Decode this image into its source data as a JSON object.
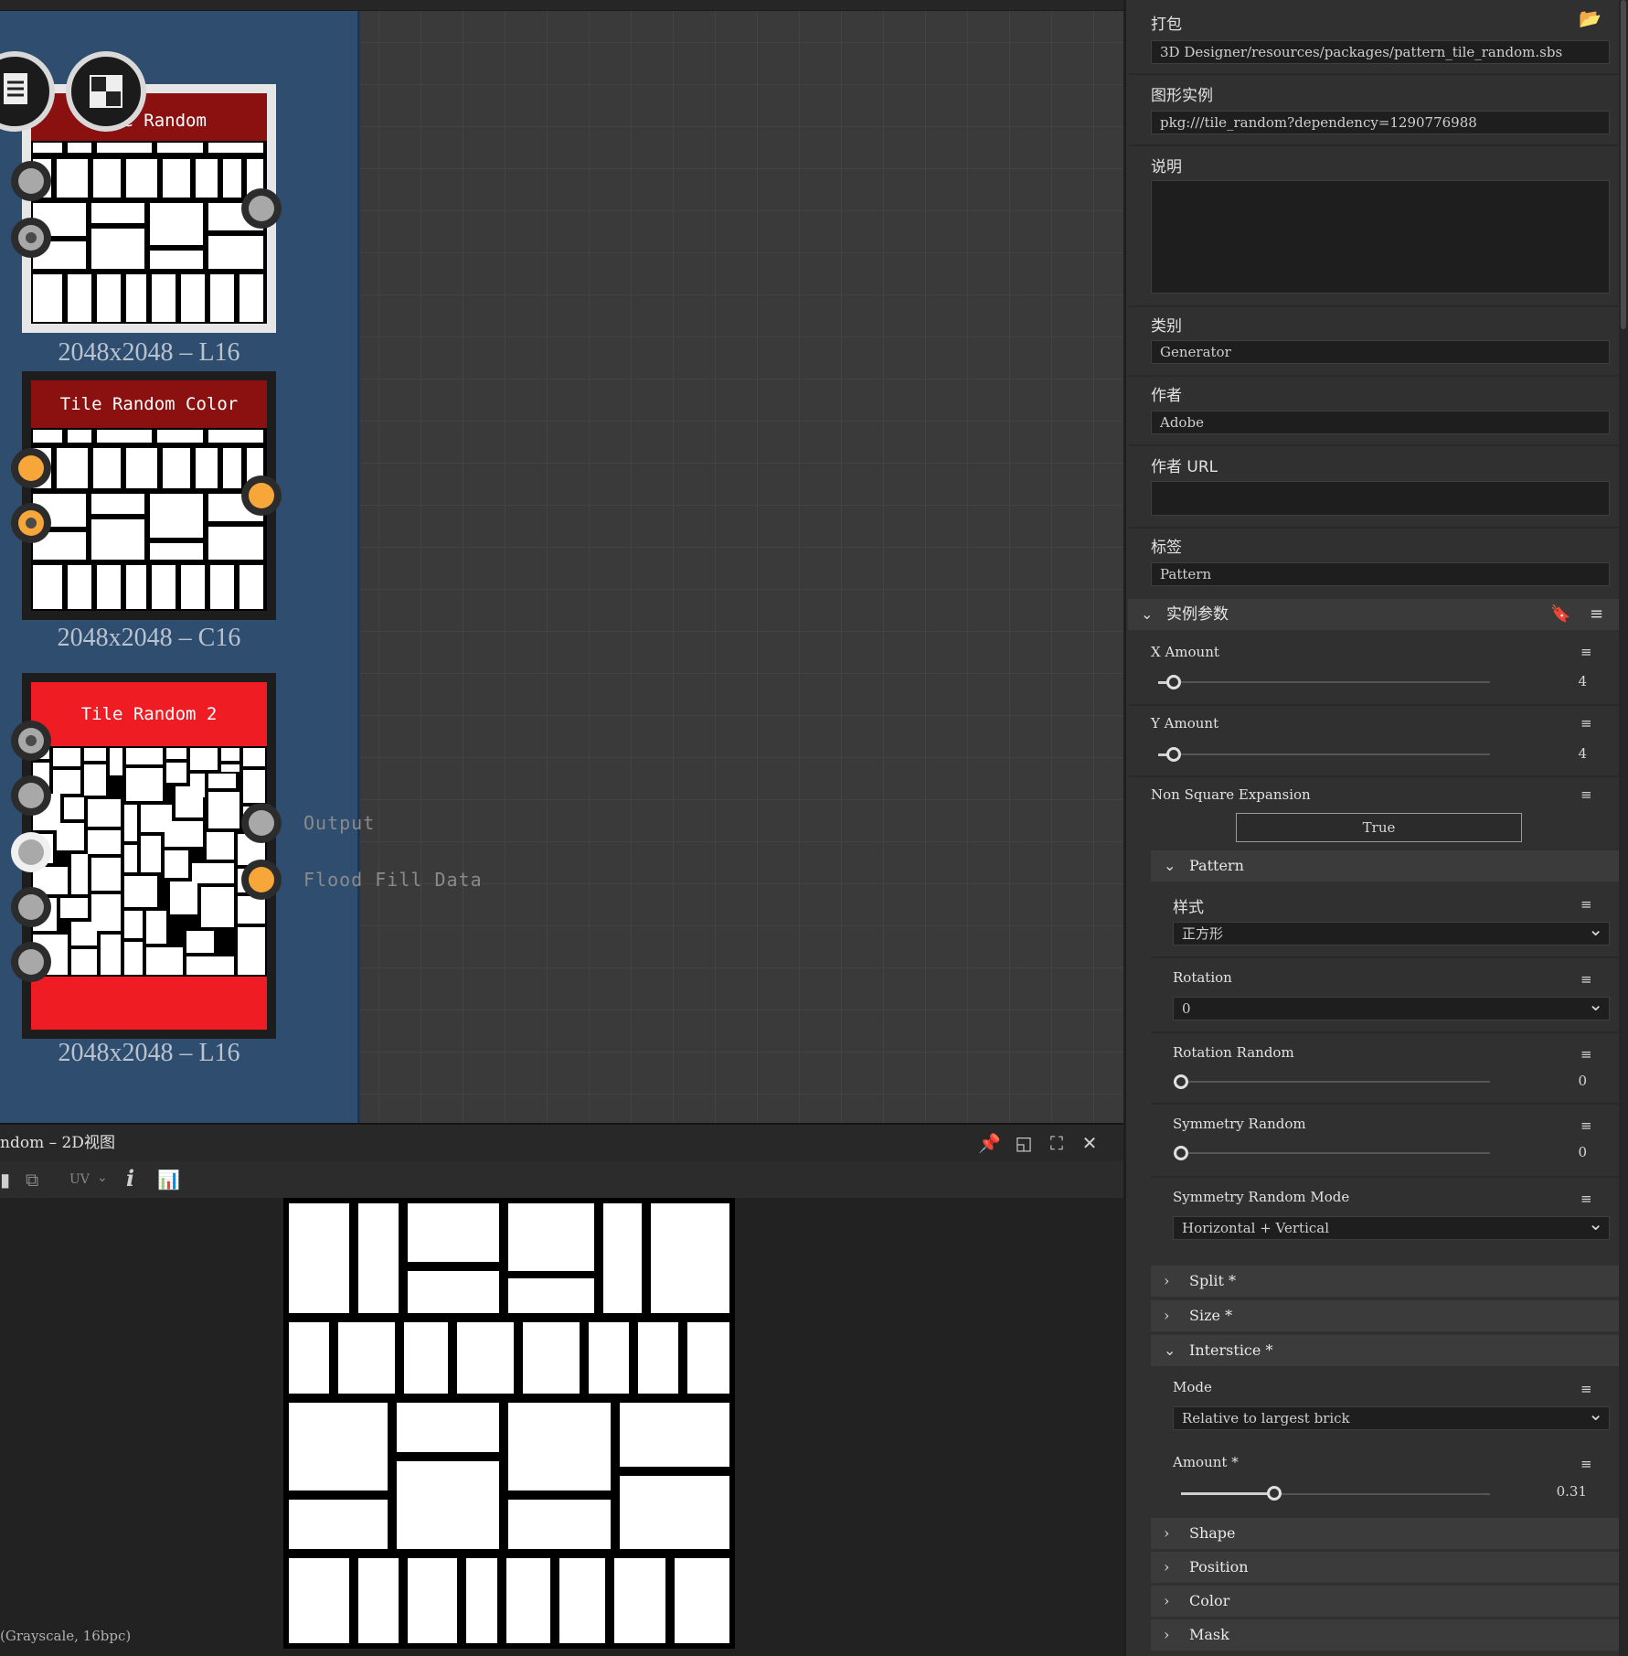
{
  "graph": {
    "nodes": [
      {
        "title": "Tile Random",
        "resolution": "2048x2048 – L16"
      },
      {
        "title": "Tile Random Color",
        "resolution": "2048x2048 – C16"
      },
      {
        "title": "Tile Random 2",
        "resolution": "2048x2048 – L16"
      }
    ],
    "outputs": [
      "Output",
      "Flood Fill Data"
    ],
    "colors": {
      "frame": "#2f4e6f",
      "header_dark_red": "#8b1010",
      "header_red": "#f01c24",
      "port_gray": "#a8a8a8",
      "port_orange": "#f7a63a"
    }
  },
  "view2d": {
    "title": "ndom – 2D视图",
    "uv_label": "UV",
    "info_icon": "i",
    "status": "(Grayscale, 16bpc)",
    "icons": [
      "pin-icon",
      "float-window-icon",
      "maximize-icon",
      "close-icon",
      "info-icon",
      "histogram-icon"
    ]
  },
  "panel": {
    "package": {
      "label": "打包",
      "value": "3D Designer/resources/packages/pattern_tile_random.sbs"
    },
    "graph_instance": {
      "label": "图形实例",
      "value": "pkg:///tile_random?dependency=1290776988"
    },
    "description": {
      "label": "说明",
      "value": ""
    },
    "category": {
      "label": "类别",
      "value": "Generator"
    },
    "author": {
      "label": "作者",
      "value": "Adobe"
    },
    "author_url": {
      "label": "作者 URL",
      "value": ""
    },
    "tags": {
      "label": "标签",
      "value": "Pattern"
    },
    "instance_params": {
      "label": "实例参数"
    },
    "x_amount": {
      "label": "X Amount",
      "value": "4",
      "level": 0.0
    },
    "y_amount": {
      "label": "Y Amount",
      "value": "4",
      "level": 0.0
    },
    "non_square": {
      "label": "Non Square Expansion",
      "value": "True"
    },
    "pattern_group": {
      "label": "Pattern"
    },
    "style": {
      "label": "样式",
      "value": "正方形"
    },
    "rotation": {
      "label": "Rotation",
      "value": "0"
    },
    "rotation_random": {
      "label": "Rotation Random",
      "value": "0",
      "level": 0.0
    },
    "symmetry_random": {
      "label": "Symmetry Random",
      "value": "0",
      "level": 0.0
    },
    "symmetry_mode": {
      "label": "Symmetry Random Mode",
      "value": "Horizontal + Vertical"
    },
    "split": {
      "label": "Split *"
    },
    "size": {
      "label": "Size *"
    },
    "interstice": {
      "label": "Interstice *"
    },
    "mode": {
      "label": "Mode",
      "value": "Relative to largest brick"
    },
    "amount": {
      "label": "Amount *",
      "value": "0.31",
      "level": 0.31
    },
    "shape": {
      "label": "Shape"
    },
    "position": {
      "label": "Position"
    },
    "color": {
      "label": "Color"
    },
    "mask": {
      "label": "Mask"
    }
  }
}
